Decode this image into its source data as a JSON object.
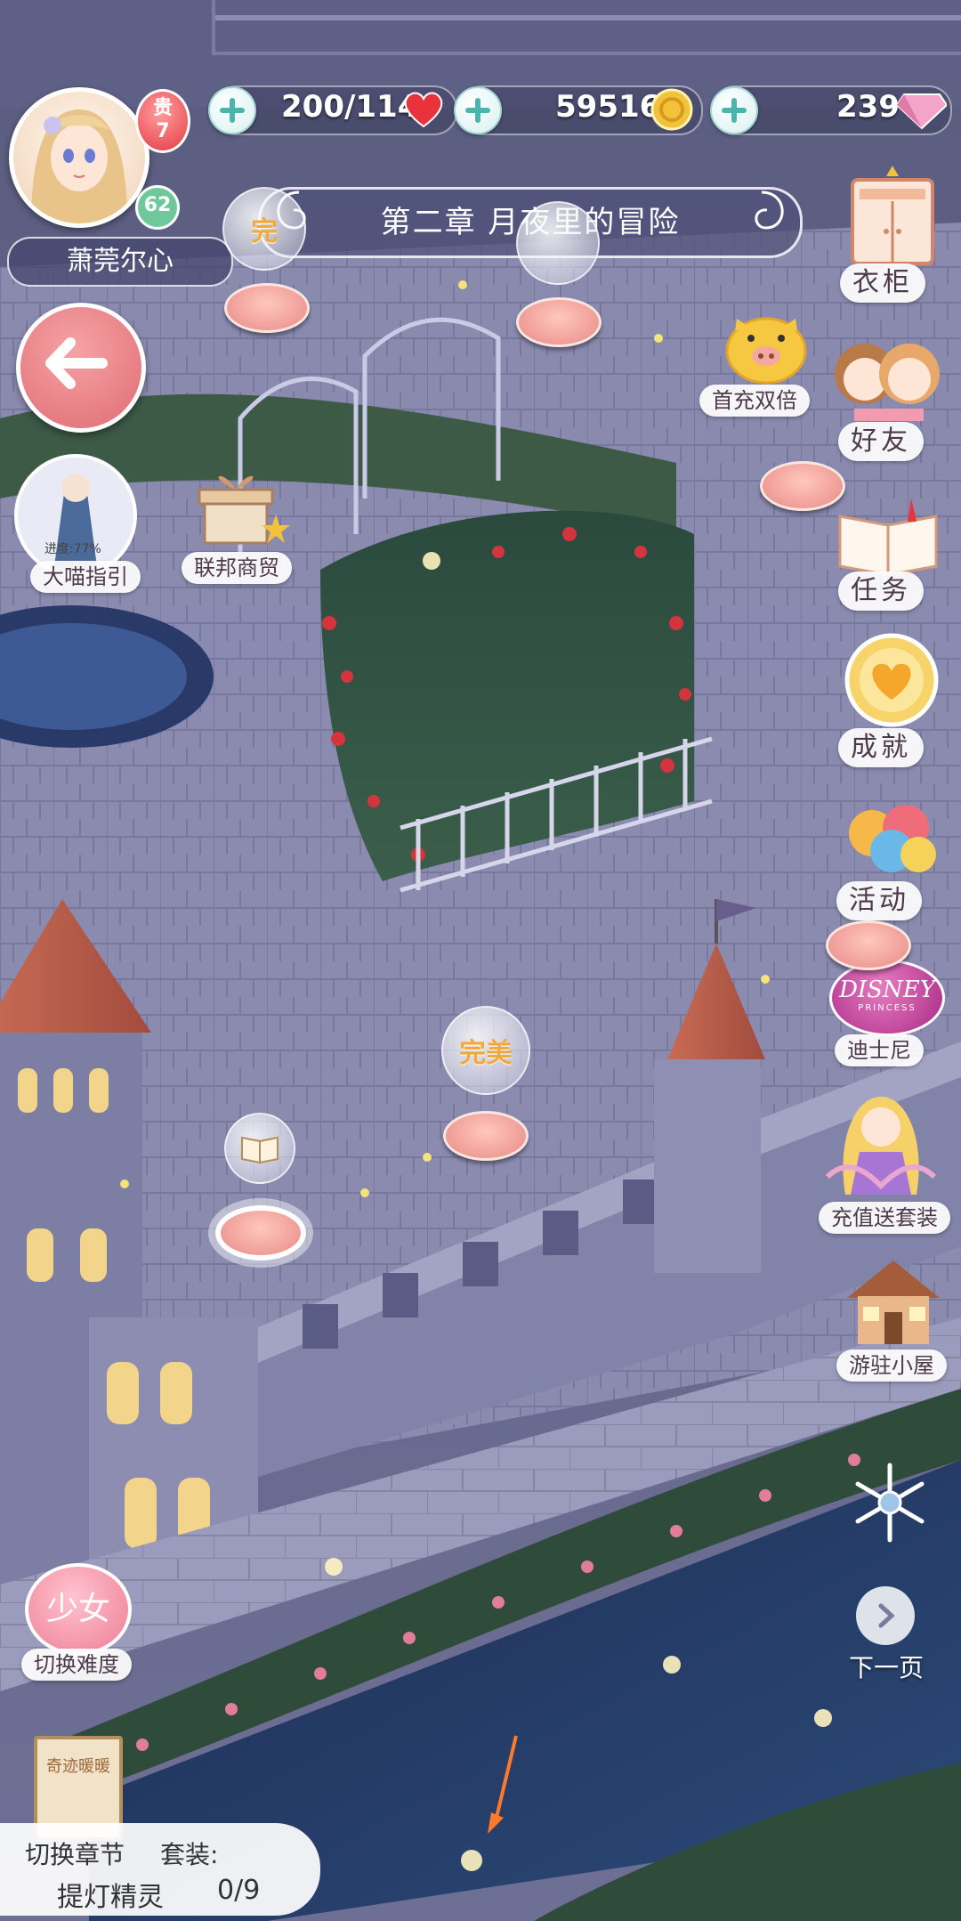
{
  "resources": {
    "stamina": "200/114",
    "coins": "59516",
    "diamonds": "239"
  },
  "player": {
    "name": "萧莞尔心",
    "rank_label": "贵",
    "rank_value": "7",
    "level": "62"
  },
  "chapter": {
    "title": "第二章 月夜里的冒险"
  },
  "left_menu": {
    "guide_progress": "进度:77%",
    "guide_label": "大喵指引",
    "trade_label": "联邦商贸",
    "difficulty_badge": "少女",
    "difficulty_label": "切换难度",
    "book_title": "奇迹暖暖"
  },
  "right_menu": [
    {
      "label": "衣柜"
    },
    {
      "label": "首充双倍"
    },
    {
      "label": "好友"
    },
    {
      "label": "任务"
    },
    {
      "label": "成就"
    },
    {
      "label": "活动"
    },
    {
      "label": "迪士尼"
    },
    {
      "label": "充值送套装"
    },
    {
      "label": "游驻小屋"
    },
    {
      "label": "下一页"
    }
  ],
  "stages": {
    "perfect_label": "完美",
    "perfect_partial": "完"
  },
  "bottom_panel": {
    "switch_chapter": "切换章节",
    "suit_label": "套装:",
    "suit_name": "提灯精灵",
    "suit_progress": "0/9"
  },
  "disney_logo": "DISNEY",
  "disney_sub": "PRINCESS",
  "colors": {
    "accent_pink": "#e06c73",
    "coin_gold": "#f2c23b",
    "heart_red": "#e8333d",
    "teal_plus": "#4bb5ad"
  }
}
